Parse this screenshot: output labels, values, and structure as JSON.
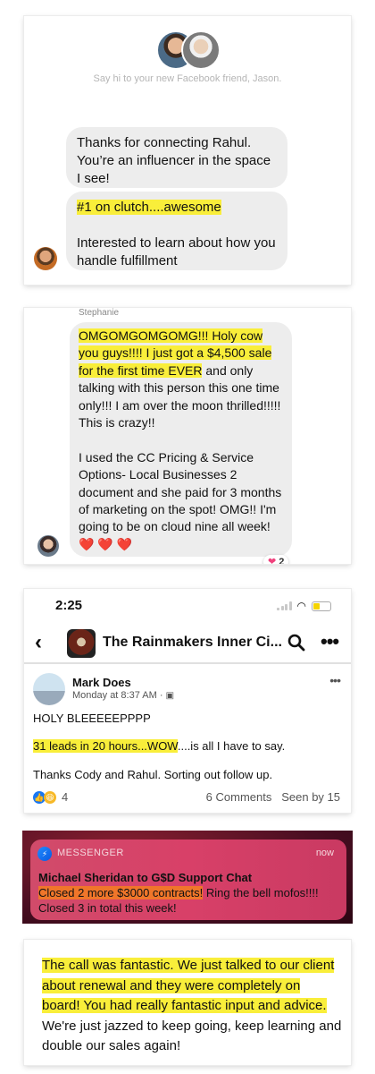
{
  "card1": {
    "subtitle": "Say hi to your new Facebook friend, Jason.",
    "bubble1": "Thanks for connecting Rahul. You’re an influencer in the space I see!",
    "bubble2_highlight": "#1 on clutch....awesome",
    "bubble2_rest": "Interested to learn about how you handle fulfillment"
  },
  "card2": {
    "sender": "Stephanie",
    "highlight": "OMGOMGOMGOMG!!! Holy cow you guys!!!! I just got a $4,500 sale for the first time EVER",
    "after_highlight": " and only talking with this person this one time only!!! I am over the moon thrilled!!!!! This is crazy!!",
    "para2": "I used the CC Pricing & Service Options- Local Businesses 2 document and she paid for 3 months of marketing on the spot! OMG!! I'm going to be on cloud nine all week! ❤️ ❤️ ❤️",
    "reaction_icon": "heart",
    "reaction_count": "2"
  },
  "card3": {
    "time": "2:25",
    "battery_level": 0.4,
    "back_icon": "chevron-left-icon",
    "group_name": "The Rainmakers Inner Ci...",
    "post": {
      "author": "Mark Does",
      "meta": "Monday at 8:37 AM · ",
      "line1": "HOLY BLEEEEEPPPP",
      "line2_highlight": "31 leads in 20 hours...WOW",
      "line2_rest": "....is all I have to say.",
      "line3": "Thanks Cody and Rahul.  Sorting out follow up.",
      "reaction_count": "4",
      "comments": "6 Comments",
      "seen": "Seen by 15"
    }
  },
  "card4": {
    "app": "MESSENGER",
    "when": "now",
    "title": "Michael Sheridan to G$D Support Chat",
    "body_highlight": "Closed 2 more $3000 contracts!",
    "body_rest": " Ring the bell mofos!!!! Closed 3 in total this week!"
  },
  "card5": {
    "highlight": "The call was fantastic. We just talked to our client about renewal and they were completely on board! You had really fantastic input and advice.",
    "rest": " We're just jazzed to keep going, keep learning and double our sales again!"
  }
}
